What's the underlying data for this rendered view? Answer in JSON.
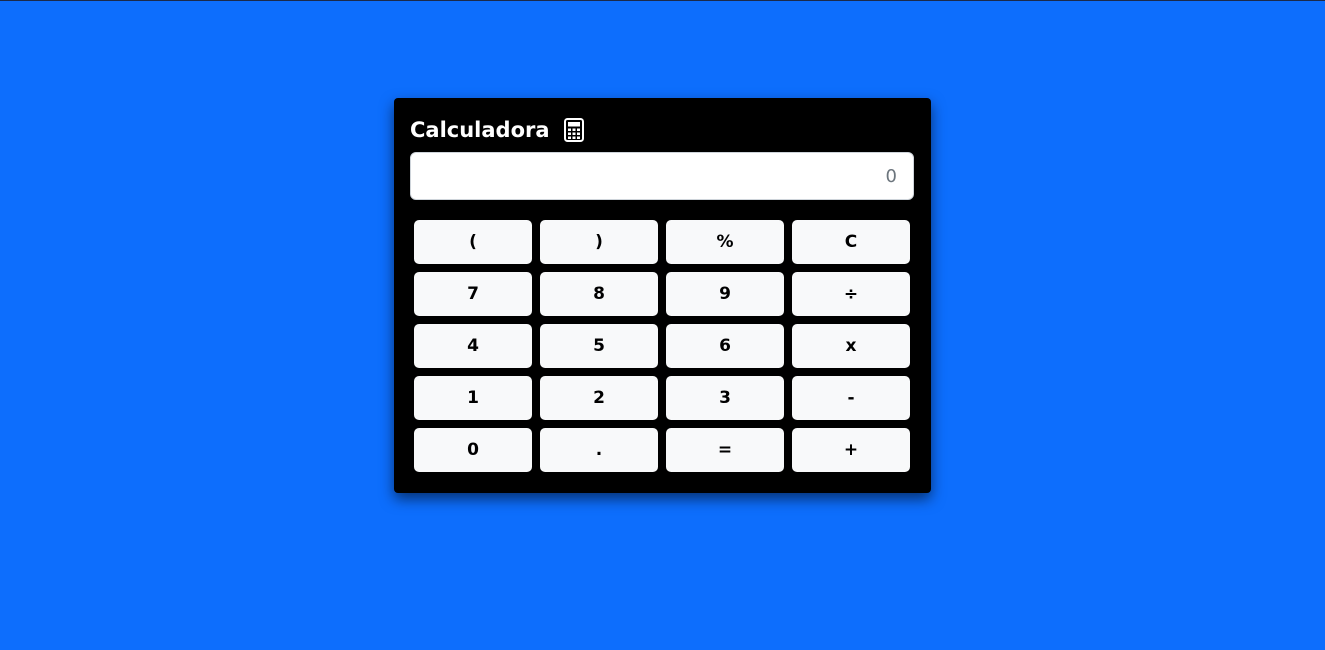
{
  "calculator": {
    "title": "Calculadora",
    "icon": "calculator-icon",
    "display": {
      "value": "",
      "placeholder": "0"
    },
    "keys": [
      {
        "label": "(",
        "name": "key-open-paren"
      },
      {
        "label": ")",
        "name": "key-close-paren"
      },
      {
        "label": "%",
        "name": "key-percent"
      },
      {
        "label": "C",
        "name": "key-clear"
      },
      {
        "label": "7",
        "name": "key-7"
      },
      {
        "label": "8",
        "name": "key-8"
      },
      {
        "label": "9",
        "name": "key-9"
      },
      {
        "label": "÷",
        "name": "key-divide"
      },
      {
        "label": "4",
        "name": "key-4"
      },
      {
        "label": "5",
        "name": "key-5"
      },
      {
        "label": "6",
        "name": "key-6"
      },
      {
        "label": "x",
        "name": "key-multiply"
      },
      {
        "label": "1",
        "name": "key-1"
      },
      {
        "label": "2",
        "name": "key-2"
      },
      {
        "label": "3",
        "name": "key-3"
      },
      {
        "label": "-",
        "name": "key-subtract"
      },
      {
        "label": "0",
        "name": "key-0"
      },
      {
        "label": ".",
        "name": "key-decimal"
      },
      {
        "label": "=",
        "name": "key-equals"
      },
      {
        "label": "+",
        "name": "key-add"
      }
    ]
  },
  "colors": {
    "page_background": "#0d6efd",
    "panel_background": "#000000",
    "key_background": "#f8f9fa"
  }
}
